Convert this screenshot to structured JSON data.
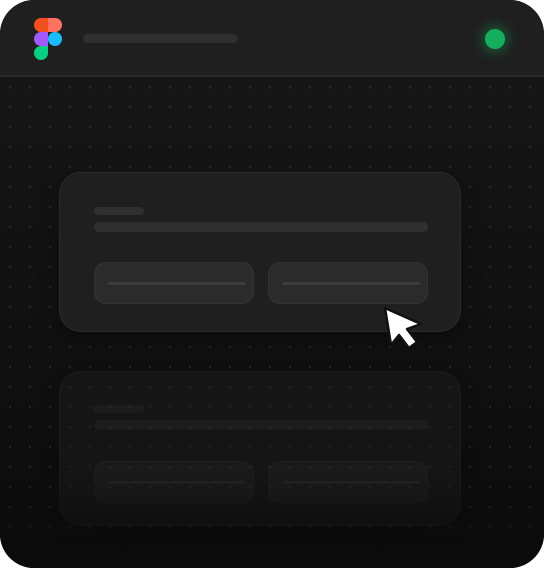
{
  "app": {
    "title": "",
    "logo_icon": "figma-logo-icon",
    "status": {
      "icon": "status-dot-icon",
      "color": "#14ae5c"
    }
  },
  "canvas": {
    "background": "dot-grid",
    "cards": [
      {
        "name": "placeholder-card-1",
        "state": "active"
      },
      {
        "name": "placeholder-card-2",
        "state": "faded"
      }
    ]
  },
  "cursor": {
    "icon": "mouse-pointer-icon"
  },
  "colors": {
    "figma_red": "#f24e1e",
    "figma_orange": "#ff7262",
    "figma_purple": "#a259ff",
    "figma_blue": "#1abcfe",
    "figma_green": "#0acf83",
    "status_green": "#14ae5c",
    "window_bg": "#0d0d0d",
    "card_bg": "#1f1f1f"
  }
}
